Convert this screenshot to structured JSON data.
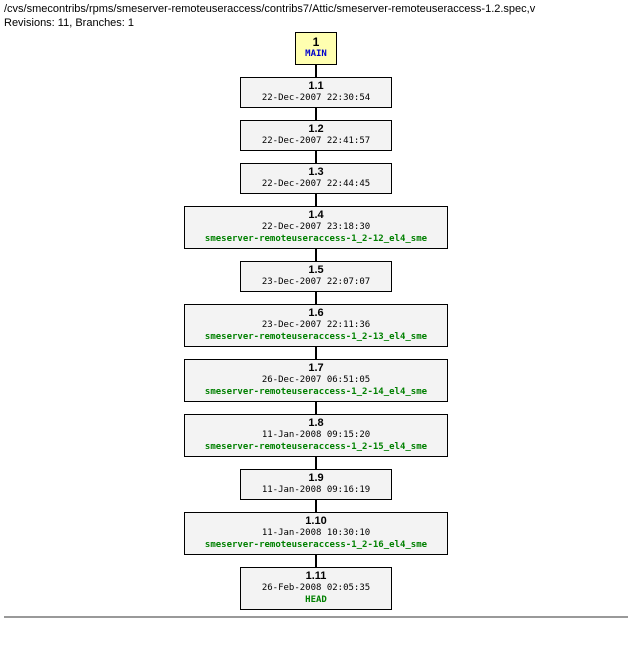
{
  "header": {
    "path": "/cvs/smecontribs/rpms/smeserver-remoteuseraccess/contribs7/Attic/smeserver-remoteuseraccess-1.2.spec,v",
    "meta": "Revisions: 11, Branches: 1"
  },
  "branch": {
    "num": "1",
    "name": "MAIN"
  },
  "nodes": [
    {
      "rev": "1.1",
      "date": "22-Dec-2007 22:30:54",
      "tag": null,
      "wide": false
    },
    {
      "rev": "1.2",
      "date": "22-Dec-2007 22:41:57",
      "tag": null,
      "wide": false
    },
    {
      "rev": "1.3",
      "date": "22-Dec-2007 22:44:45",
      "tag": null,
      "wide": false
    },
    {
      "rev": "1.4",
      "date": "22-Dec-2007 23:18:30",
      "tag": "smeserver-remoteuseraccess-1_2-12_el4_sme",
      "wide": true
    },
    {
      "rev": "1.5",
      "date": "23-Dec-2007 22:07:07",
      "tag": null,
      "wide": false
    },
    {
      "rev": "1.6",
      "date": "23-Dec-2007 22:11:36",
      "tag": "smeserver-remoteuseraccess-1_2-13_el4_sme",
      "wide": true
    },
    {
      "rev": "1.7",
      "date": "26-Dec-2007 06:51:05",
      "tag": "smeserver-remoteuseraccess-1_2-14_el4_sme",
      "wide": true
    },
    {
      "rev": "1.8",
      "date": "11-Jan-2008 09:15:20",
      "tag": "smeserver-remoteuseraccess-1_2-15_el4_sme",
      "wide": true
    },
    {
      "rev": "1.9",
      "date": "11-Jan-2008 09:16:19",
      "tag": null,
      "wide": false
    },
    {
      "rev": "1.10",
      "date": "11-Jan-2008 10:30:10",
      "tag": "smeserver-remoteuseraccess-1_2-16_el4_sme",
      "wide": true
    },
    {
      "rev": "1.11",
      "date": "26-Feb-2008 02:05:35",
      "tag": "HEAD",
      "wide": false
    }
  ]
}
